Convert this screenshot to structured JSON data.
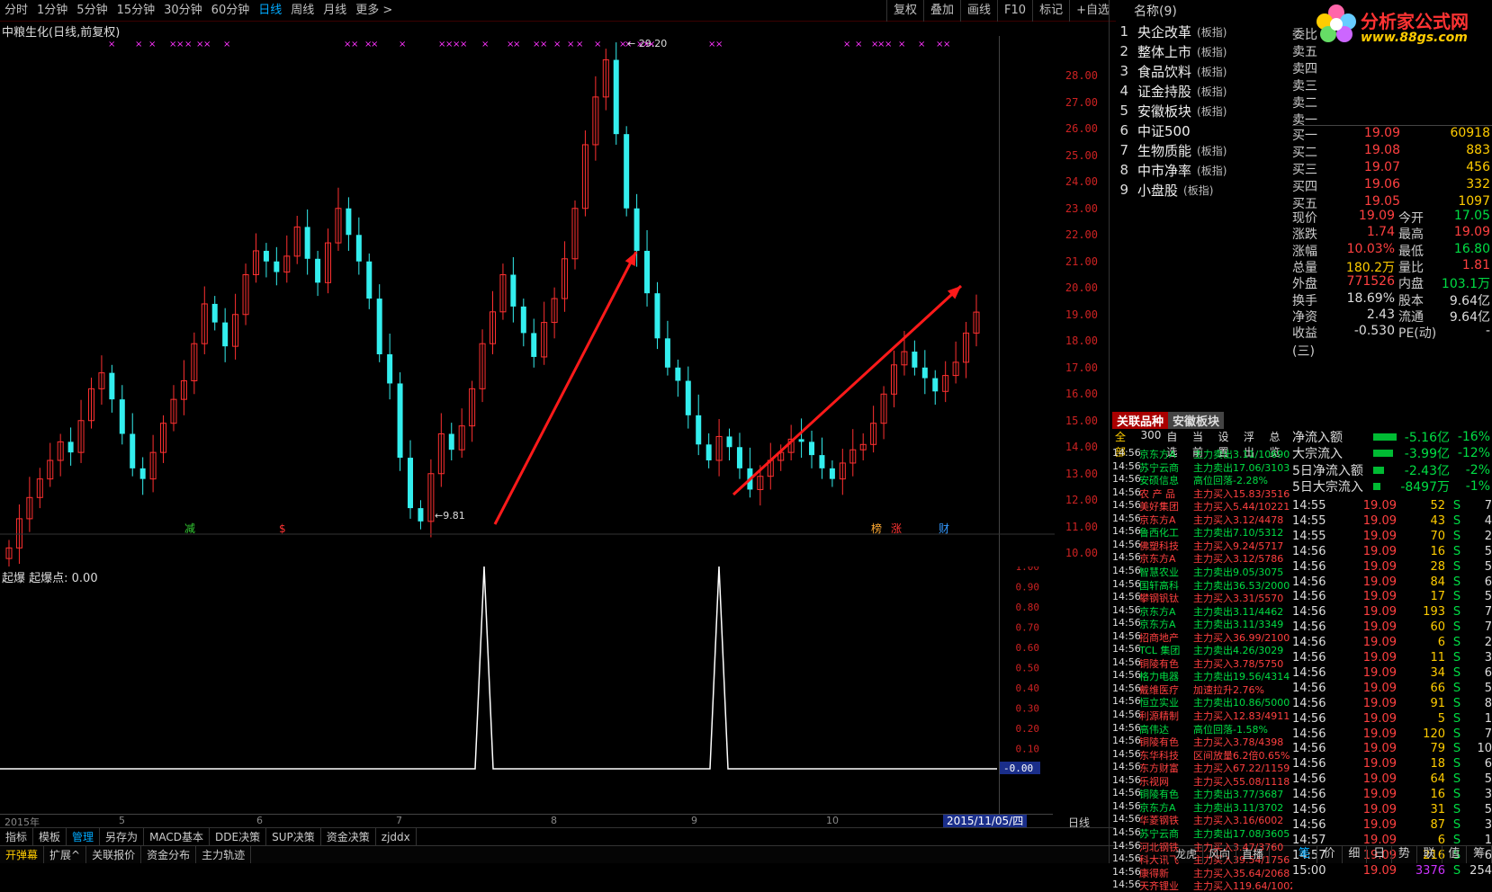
{
  "toolbar": {
    "timeframes": [
      "分时",
      "1分钟",
      "5分钟",
      "15分钟",
      "30分钟",
      "60分钟",
      "日线",
      "周线",
      "月线",
      "更多 >"
    ],
    "active_timeframe": "日线",
    "right_tools": [
      "复权",
      "叠加",
      "画线",
      "F10",
      "标记",
      "+自选"
    ]
  },
  "chart": {
    "title": "中粮生化(日线,前复权)",
    "high_label": "29.20",
    "low_label": "9.81",
    "y_ticks": [
      "28.00",
      "27.00",
      "26.00",
      "25.00",
      "24.00",
      "23.00",
      "22.00",
      "21.00",
      "20.00",
      "19.00",
      "18.00",
      "17.00",
      "16.00",
      "15.00",
      "14.00",
      "13.00",
      "12.00",
      "11.00",
      "10.00"
    ],
    "markers": [
      "减",
      "$",
      "榜",
      "涨",
      "财"
    ],
    "indicator_label": "起爆 起爆点: 0.00",
    "sub_ticks": [
      "1.00",
      "0.90",
      "0.80",
      "0.70",
      "0.60",
      "0.50",
      "0.40",
      "0.30",
      "0.20",
      "0.10"
    ],
    "sub_value": "-0.00",
    "date_labels": [
      "2015年",
      "5",
      "6",
      "7",
      "8",
      "9",
      "10"
    ],
    "date_badge": "2015/11/05/四",
    "period": "日线"
  },
  "chart_data": {
    "type": "candlestick",
    "title": "中粮生化(日线,前复权)",
    "annotations": {
      "high": 29.2,
      "low": 9.81
    },
    "ylim": [
      9.5,
      29.5
    ],
    "indicator": {
      "name": "起爆",
      "spikes_at": [
        "2015-07-30",
        "2015-09-18"
      ],
      "spike_value": 1.0,
      "ylim": [
        0,
        1.0
      ]
    },
    "series_approx_close": [
      10.2,
      11.3,
      12.1,
      12.8,
      13.5,
      14.2,
      13.8,
      15.0,
      16.2,
      16.8,
      15.8,
      14.5,
      13.2,
      12.8,
      13.8,
      14.9,
      15.8,
      16.5,
      17.9,
      19.4,
      18.7,
      17.8,
      19.0,
      20.5,
      21.4,
      21.0,
      20.6,
      21.2,
      22.3,
      21.1,
      20.2,
      21.7,
      23.0,
      22.0,
      21.0,
      19.6,
      17.5,
      16.4,
      13.6,
      11.7,
      11.2,
      13.0,
      14.5,
      13.9,
      14.8,
      16.2,
      17.9,
      19.1,
      20.5,
      19.3,
      18.3,
      17.4,
      18.7,
      19.6,
      21.1,
      23.0,
      25.4,
      27.2,
      28.6,
      25.8,
      23.0,
      21.4,
      19.8,
      18.1,
      17.0,
      16.5,
      15.2,
      14.1,
      13.5,
      14.4,
      14.0,
      13.2,
      12.4,
      12.9,
      13.5,
      13.8,
      14.3,
      14.2,
      13.7,
      13.2,
      12.8,
      13.4,
      13.9,
      14.1,
      14.9,
      16.0,
      17.1,
      17.6,
      17.0,
      16.6,
      16.1,
      16.7,
      17.2,
      18.3,
      19.09
    ]
  },
  "sectors": {
    "header": "名称(9)",
    "items": [
      {
        "idx": "1",
        "name": "央企改革",
        "tag": "(板指)"
      },
      {
        "idx": "2",
        "name": "整体上市",
        "tag": "(板指)"
      },
      {
        "idx": "3",
        "name": "食品饮料",
        "tag": "(板指)"
      },
      {
        "idx": "4",
        "name": "证金持股",
        "tag": "(板指)"
      },
      {
        "idx": "5",
        "name": "安徽板块",
        "tag": "(板指)"
      },
      {
        "idx": "6",
        "name": "中证500",
        "tag": ""
      },
      {
        "idx": "7",
        "name": "生物质能",
        "tag": "(板指)"
      },
      {
        "idx": "8",
        "name": "中市净率",
        "tag": "(板指)"
      },
      {
        "idx": "9",
        "name": "小盘股",
        "tag": "(板指)"
      }
    ]
  },
  "logo": {
    "name": "分析家公式网",
    "url": "www.88gs.com"
  },
  "orderbook": {
    "asks": [
      {
        "label": "委比",
        "price": "",
        "vol": ""
      },
      {
        "label": "卖五",
        "price": "",
        "vol": ""
      },
      {
        "label": "卖四",
        "price": "",
        "vol": ""
      },
      {
        "label": "卖三",
        "price": "",
        "vol": ""
      },
      {
        "label": "卖二",
        "price": "",
        "vol": ""
      },
      {
        "label": "卖一",
        "price": "",
        "vol": ""
      }
    ],
    "bids": [
      {
        "label": "买一",
        "price": "19.09",
        "vol": "60918"
      },
      {
        "label": "买二",
        "price": "19.08",
        "vol": "883"
      },
      {
        "label": "买三",
        "price": "19.07",
        "vol": "456"
      },
      {
        "label": "买四",
        "price": "19.06",
        "vol": "332"
      },
      {
        "label": "买五",
        "price": "19.05",
        "vol": "1097"
      }
    ]
  },
  "quote": [
    {
      "l1": "现价",
      "v1": "19.09",
      "l2": "今开",
      "v2": "17.05"
    },
    {
      "l1": "涨跌",
      "v1": "1.74",
      "l2": "最高",
      "v2": "19.09"
    },
    {
      "l1": "涨幅",
      "v1": "10.03%",
      "l2": "最低",
      "v2": "16.80"
    },
    {
      "l1": "总量",
      "v1": "180.2万",
      "l2": "量比",
      "v2": "1.81"
    },
    {
      "l1": "外盘",
      "v1": "771526",
      "l2": "内盘",
      "v2": "103.1万"
    },
    {
      "l1": "换手",
      "v1": "18.69%",
      "l2": "股本",
      "v2": "9.64亿"
    },
    {
      "l1": "净资",
      "v1": "2.43",
      "l2": "流通",
      "v2": "9.64亿"
    },
    {
      "l1": "收益(三)",
      "v1": "-0.530",
      "l2": "PE(动)",
      "v2": "-"
    }
  ],
  "related": {
    "tabs": [
      "关联品种",
      "安徽板块"
    ],
    "sub": [
      "全部",
      "300",
      "自选",
      "当前",
      "设置",
      "浮出",
      "总览"
    ]
  },
  "feed": [
    {
      "t": "14:56",
      "n": "京东方A",
      "a": "主力卖出3.11/10690",
      "c": "#00dd44"
    },
    {
      "t": "14:56",
      "n": "苏宁云商",
      "a": "主力卖出17.06/3103",
      "c": "#00dd44"
    },
    {
      "t": "14:56",
      "n": "安硕信息",
      "a": "高位回落-2.28%",
      "c": "#00dd44"
    },
    {
      "t": "14:56",
      "n": "农 产 品",
      "a": "主力买入15.83/3516",
      "c": "#ff4040"
    },
    {
      "t": "14:56",
      "n": "美好集团",
      "a": "主力买入5.44/10221",
      "c": "#ff4040"
    },
    {
      "t": "14:56",
      "n": "京东方A",
      "a": "主力买入3.12/4478",
      "c": "#ff4040"
    },
    {
      "t": "14:56",
      "n": "鲁西化工",
      "a": "主力卖出7.10/5312",
      "c": "#00dd44"
    },
    {
      "t": "14:56",
      "n": "佛塑科技",
      "a": "主力买入9.24/5717",
      "c": "#ff4040"
    },
    {
      "t": "14:56",
      "n": "京东方A",
      "a": "主力买入3.12/5786",
      "c": "#ff4040"
    },
    {
      "t": "14:56",
      "n": "智慧农业",
      "a": "主力卖出9.05/3075",
      "c": "#00dd44"
    },
    {
      "t": "14:56",
      "n": "国轩高科",
      "a": "主力卖出36.53/2000",
      "c": "#00dd44"
    },
    {
      "t": "14:56",
      "n": "攀钢钒钛",
      "a": "主力买入3.31/5570",
      "c": "#ff4040"
    },
    {
      "t": "14:56",
      "n": "京东方A",
      "a": "主力卖出3.11/4462",
      "c": "#00dd44"
    },
    {
      "t": "14:56",
      "n": "京东方A",
      "a": "主力卖出3.11/3349",
      "c": "#00dd44"
    },
    {
      "t": "14:56",
      "n": "招商地产",
      "a": "主力买入36.99/2100",
      "c": "#ff4040"
    },
    {
      "t": "14:56",
      "n": "TCL 集团",
      "a": "主力卖出4.26/3029",
      "c": "#00dd44"
    },
    {
      "t": "14:56",
      "n": "铜陵有色",
      "a": "主力买入3.78/5750",
      "c": "#ff4040"
    },
    {
      "t": "14:56",
      "n": "格力电器",
      "a": "主力卖出19.56/4314",
      "c": "#00dd44"
    },
    {
      "t": "14:56",
      "n": "戴维医疗",
      "a": "加速拉升2.76%",
      "c": "#ff4040"
    },
    {
      "t": "14:56",
      "n": "恒立实业",
      "a": "主力卖出10.86/5000",
      "c": "#00dd44"
    },
    {
      "t": "14:56",
      "n": "利源精制",
      "a": "主力买入12.83/4911",
      "c": "#ff4040"
    },
    {
      "t": "14:56",
      "n": "高伟达",
      "a": "高位回落-1.58%",
      "c": "#00dd44"
    },
    {
      "t": "14:56",
      "n": "铜陵有色",
      "a": "主力买入3.78/4398",
      "c": "#ff4040"
    },
    {
      "t": "14:56",
      "n": "东华科技",
      "a": "区间放量6.2倍0.65%",
      "c": "#ff4040"
    },
    {
      "t": "14:56",
      "n": "东方财富",
      "a": "主力买入67.22/1159",
      "c": "#ff4040"
    },
    {
      "t": "14:56",
      "n": "乐视网",
      "a": "主力买入55.08/1118",
      "c": "#ff4040"
    },
    {
      "t": "14:56",
      "n": "铜陵有色",
      "a": "主力卖出3.77/3687",
      "c": "#00dd44"
    },
    {
      "t": "14:56",
      "n": "京东方A",
      "a": "主力卖出3.11/3702",
      "c": "#00dd44"
    },
    {
      "t": "14:56",
      "n": "华菱钢铁",
      "a": "主力买入3.16/6002",
      "c": "#ff4040"
    },
    {
      "t": "14:56",
      "n": "苏宁云商",
      "a": "主力卖出17.08/3605",
      "c": "#00dd44"
    },
    {
      "t": "14:56",
      "n": "河北钢铁",
      "a": "主力买入3.47/3760",
      "c": "#ff4040"
    },
    {
      "t": "14:56",
      "n": "科大讯飞",
      "a": "主力买入39.54/1756",
      "c": "#ff4040"
    },
    {
      "t": "14:56",
      "n": "康得新",
      "a": "主力买入35.64/2068",
      "c": "#ff4040"
    },
    {
      "t": "14:56",
      "n": "天齐锂业",
      "a": "主力买入119.64/1002",
      "c": "#ff4040"
    }
  ],
  "flows": [
    {
      "label": "净流入额",
      "val": "-5.16亿",
      "pct": "-16%"
    },
    {
      "label": "大宗流入",
      "val": "-3.99亿",
      "pct": "-12%"
    },
    {
      "label": "5日净流入额",
      "val": "-2.43亿",
      "pct": "-2%"
    },
    {
      "label": "5日大宗流入",
      "val": "-8497万",
      "pct": "-1%"
    }
  ],
  "ticks": [
    {
      "t": "14:55",
      "p": "19.09",
      "v": "52",
      "s": "S",
      "c": "7"
    },
    {
      "t": "14:55",
      "p": "19.09",
      "v": "43",
      "s": "S",
      "c": "4"
    },
    {
      "t": "14:55",
      "p": "19.09",
      "v": "70",
      "s": "S",
      "c": "2"
    },
    {
      "t": "14:56",
      "p": "19.09",
      "v": "16",
      "s": "S",
      "c": "5"
    },
    {
      "t": "14:56",
      "p": "19.09",
      "v": "28",
      "s": "S",
      "c": "5"
    },
    {
      "t": "14:56",
      "p": "19.09",
      "v": "84",
      "s": "S",
      "c": "6"
    },
    {
      "t": "14:56",
      "p": "19.09",
      "v": "17",
      "s": "S",
      "c": "5"
    },
    {
      "t": "14:56",
      "p": "19.09",
      "v": "193",
      "s": "S",
      "c": "7"
    },
    {
      "t": "14:56",
      "p": "19.09",
      "v": "60",
      "s": "S",
      "c": "7"
    },
    {
      "t": "14:56",
      "p": "19.09",
      "v": "6",
      "s": "S",
      "c": "2"
    },
    {
      "t": "14:56",
      "p": "19.09",
      "v": "11",
      "s": "S",
      "c": "3"
    },
    {
      "t": "14:56",
      "p": "19.09",
      "v": "34",
      "s": "S",
      "c": "6"
    },
    {
      "t": "14:56",
      "p": "19.09",
      "v": "66",
      "s": "S",
      "c": "5"
    },
    {
      "t": "14:56",
      "p": "19.09",
      "v": "91",
      "s": "S",
      "c": "8"
    },
    {
      "t": "14:56",
      "p": "19.09",
      "v": "5",
      "s": "S",
      "c": "1"
    },
    {
      "t": "14:56",
      "p": "19.09",
      "v": "120",
      "s": "S",
      "c": "7"
    },
    {
      "t": "14:56",
      "p": "19.09",
      "v": "79",
      "s": "S",
      "c": "10"
    },
    {
      "t": "14:56",
      "p": "19.09",
      "v": "18",
      "s": "S",
      "c": "6"
    },
    {
      "t": "14:56",
      "p": "19.09",
      "v": "64",
      "s": "S",
      "c": "5"
    },
    {
      "t": "14:56",
      "p": "19.09",
      "v": "16",
      "s": "S",
      "c": "3"
    },
    {
      "t": "14:56",
      "p": "19.09",
      "v": "31",
      "s": "S",
      "c": "5"
    },
    {
      "t": "14:56",
      "p": "19.09",
      "v": "87",
      "s": "S",
      "c": "3"
    },
    {
      "t": "14:57",
      "p": "19.09",
      "v": "6",
      "s": "S",
      "c": "1"
    },
    {
      "t": "14:57",
      "p": "19.09",
      "v": "216",
      "s": "S",
      "c": "6"
    },
    {
      "t": "15:00",
      "p": "19.09",
      "v": "3376",
      "s": "S",
      "c": "254"
    }
  ],
  "bottom_tabs": [
    "指标",
    "模板",
    "管理",
    "另存为",
    "MACD基本",
    "DDE决策",
    "SUP决策",
    "资金决策",
    "zjddx"
  ],
  "bottom_tabs2": [
    "开弹幕",
    "扩展^",
    "关联报价",
    "资金分布",
    "主力轨迹"
  ],
  "bottom_right": [
    "笔",
    "价",
    "细",
    "日",
    "势",
    "联",
    "值",
    "筹"
  ],
  "status_tabs": [
    "龙虎",
    "风向",
    "直播"
  ]
}
